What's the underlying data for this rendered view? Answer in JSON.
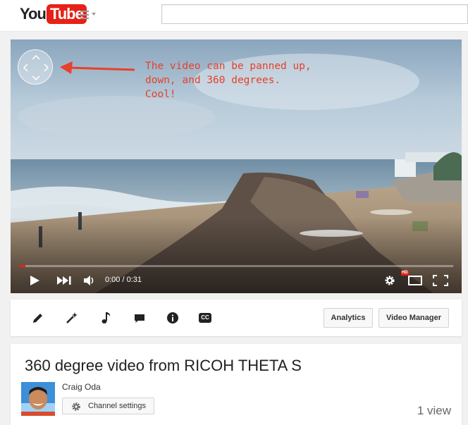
{
  "header": {
    "logo": {
      "you": "You",
      "tube": "Tube"
    },
    "search": {
      "placeholder": ""
    }
  },
  "player": {
    "annotation": "The video can be panned up, down, and 360 degrees.  Cool!",
    "time": "0:00 / 0:31",
    "progress_fraction": 0.015,
    "hd_badge": "HD"
  },
  "toolbar": {
    "tools": [
      "pencil-icon",
      "magic-wand-icon",
      "music-note-icon",
      "speech-bubble-icon",
      "info-icon",
      "cc-icon"
    ],
    "cc_label": "CC",
    "analytics_label": "Analytics",
    "video_manager_label": "Video Manager"
  },
  "video": {
    "title": "360 degree video from RICOH THETA S",
    "channel_name": "Craig Oda",
    "channel_settings_label": "Channel settings",
    "views": "1 view"
  },
  "colors": {
    "brand_red": "#e62117",
    "annotation_red": "#e8402a"
  }
}
